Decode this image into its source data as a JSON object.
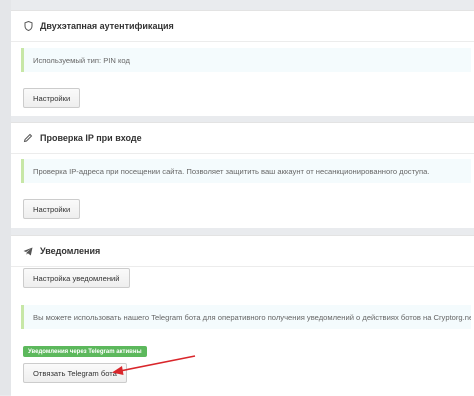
{
  "two_factor": {
    "title": "Двухэтапная аутентификация",
    "info": "Используемый тип: PIN код",
    "settings_button": "Настройки"
  },
  "ip_check": {
    "title": "Проверка IP при входе",
    "info": "Проверка IP-адреса при посещении сайта. Позволяет защитить ваш аккаунт от несанкционированного доступа.",
    "settings_button": "Настройки"
  },
  "notifications": {
    "title": "Уведомления",
    "settings_button": "Настройка уведомлений",
    "info": "Вы можете использовать нашего Telegram бота для оперативного получения уведомлений о действиях ботов на Cryptorg.net",
    "telegram_badge": "Уведомления через Telegram активны",
    "unlink_button": "Отвязать Telegram бота"
  },
  "colors": {
    "info_border": "#c7e7a7",
    "info_background": "#f4fbfd",
    "badge_green": "#5cb85c",
    "arrow_red": "#d9262b"
  },
  "icons": {
    "two_factor": "shield-icon",
    "ip_check": "pen-icon",
    "notifications": "telegram-icon"
  }
}
